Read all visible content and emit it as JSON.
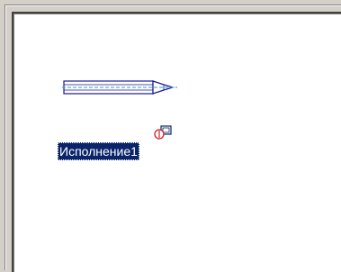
{
  "component": {
    "label": "Исполнение1",
    "icon": "component-instance-icon",
    "selected": true
  },
  "drawing": {
    "icon": "pencil-shaft-part-icon"
  },
  "colors": {
    "selection_background": "#0a246a",
    "selection_text": "#ffffff",
    "part_outline": "#1a1a8c",
    "part_axis": "#3a9ad9",
    "icon_accent": "#d02020",
    "frame": "#d4d0c8"
  }
}
